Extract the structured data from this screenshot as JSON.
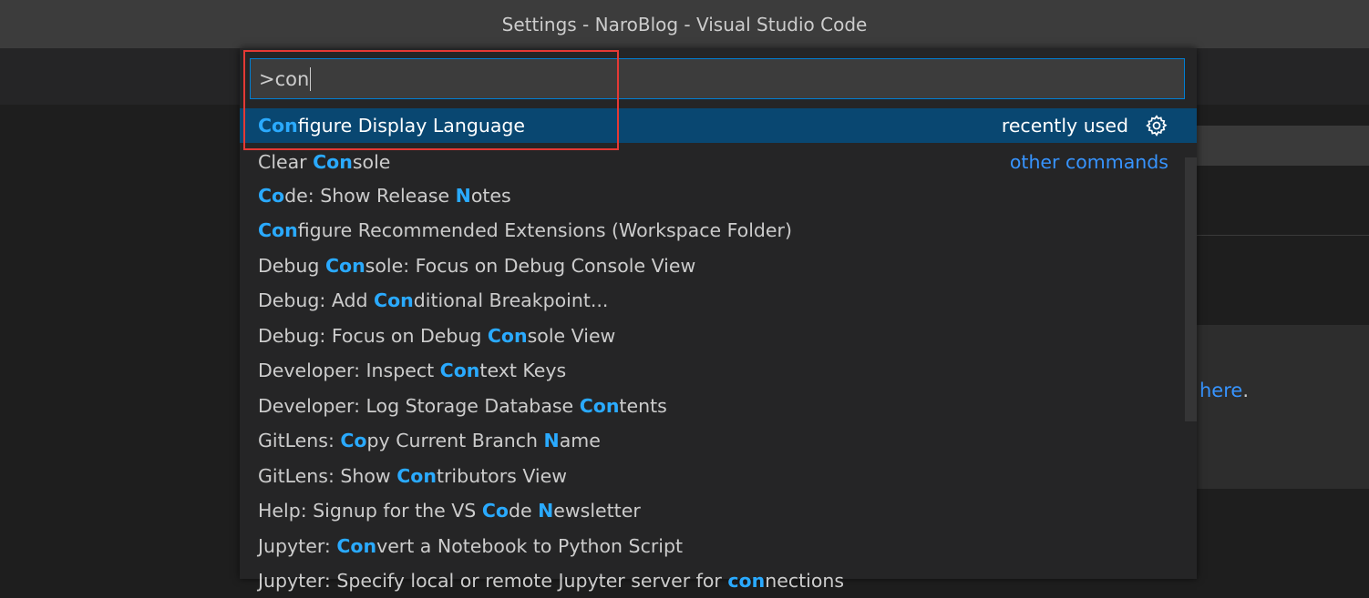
{
  "window": {
    "title": "Settings - NaroBlog - Visual Studio Code"
  },
  "background": {
    "link_text": "here",
    "link_suffix": "."
  },
  "palette": {
    "input_value": ">con",
    "items": [
      {
        "parts": [
          {
            "t": "Con",
            "h": true
          },
          {
            "t": "figure Display Language",
            "h": false
          }
        ],
        "selected": true,
        "right": "recently used",
        "gear": true
      },
      {
        "parts": [
          {
            "t": "Clear ",
            "h": false
          },
          {
            "t": "Con",
            "h": true
          },
          {
            "t": "sole",
            "h": false
          }
        ],
        "right": "other commands"
      },
      {
        "parts": [
          {
            "t": "Co",
            "h": true
          },
          {
            "t": "de: Show Release ",
            "h": false
          },
          {
            "t": "N",
            "h": true
          },
          {
            "t": "otes",
            "h": false
          }
        ]
      },
      {
        "parts": [
          {
            "t": "Con",
            "h": true
          },
          {
            "t": "figure Recommended Extensions (Workspace Folder)",
            "h": false
          }
        ]
      },
      {
        "parts": [
          {
            "t": "Debug ",
            "h": false
          },
          {
            "t": "Con",
            "h": true
          },
          {
            "t": "sole: Focus on Debug Console View",
            "h": false
          }
        ]
      },
      {
        "parts": [
          {
            "t": "Debug: Add ",
            "h": false
          },
          {
            "t": "Con",
            "h": true
          },
          {
            "t": "ditional Breakpoint...",
            "h": false
          }
        ]
      },
      {
        "parts": [
          {
            "t": "Debug: Focus on Debug ",
            "h": false
          },
          {
            "t": "Con",
            "h": true
          },
          {
            "t": "sole View",
            "h": false
          }
        ]
      },
      {
        "parts": [
          {
            "t": "Developer: Inspect ",
            "h": false
          },
          {
            "t": "Con",
            "h": true
          },
          {
            "t": "text Keys",
            "h": false
          }
        ]
      },
      {
        "parts": [
          {
            "t": "Developer: Log Storage Database ",
            "h": false
          },
          {
            "t": "Con",
            "h": true
          },
          {
            "t": "tents",
            "h": false
          }
        ]
      },
      {
        "parts": [
          {
            "t": "GitLens: ",
            "h": false
          },
          {
            "t": "Co",
            "h": true
          },
          {
            "t": "py Current Branch ",
            "h": false
          },
          {
            "t": "N",
            "h": true
          },
          {
            "t": "ame",
            "h": false
          }
        ]
      },
      {
        "parts": [
          {
            "t": "GitLens: Show ",
            "h": false
          },
          {
            "t": "Con",
            "h": true
          },
          {
            "t": "tributors View",
            "h": false
          }
        ]
      },
      {
        "parts": [
          {
            "t": "Help: Signup for the VS ",
            "h": false
          },
          {
            "t": "Co",
            "h": true
          },
          {
            "t": "de ",
            "h": false
          },
          {
            "t": "N",
            "h": true
          },
          {
            "t": "ewsletter",
            "h": false
          }
        ]
      },
      {
        "parts": [
          {
            "t": "Jupyter: ",
            "h": false
          },
          {
            "t": "Con",
            "h": true
          },
          {
            "t": "vert a Notebook to Python Script",
            "h": false
          }
        ]
      },
      {
        "parts": [
          {
            "t": "Jupyter: Specify local or remote Jupyter server for ",
            "h": false
          },
          {
            "t": "con",
            "h": true
          },
          {
            "t": "nections",
            "h": false
          }
        ]
      }
    ]
  }
}
